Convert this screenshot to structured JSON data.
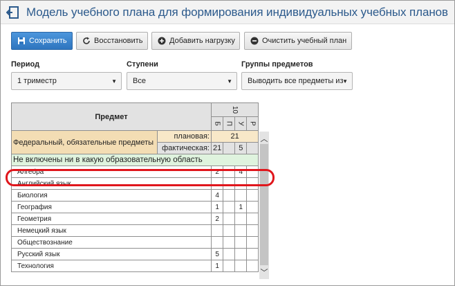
{
  "title": "Модель учебного плана для формирования индивидуальных учебных планов",
  "toolbar": {
    "save": "Сохранить",
    "restore": "Восстановить",
    "add_load": "Добавить нагрузку",
    "clear_plan": "Очистить учебный план"
  },
  "filters": {
    "period_label": "Период",
    "period_value": "1 триместр",
    "levels_label": "Ступени",
    "levels_value": "Все",
    "groups_label": "Группы предметов",
    "groups_value": "Выводить все предметы из"
  },
  "table": {
    "subject_header": "Предмет",
    "grade": "10",
    "subcols": [
      "Б",
      "П",
      "У",
      "Р"
    ],
    "federal_label": "Федеральный, обязательные предметы",
    "planned_label": "плановая:",
    "planned_value": "21",
    "actual_label": "фактическая:",
    "actual_values": [
      "21",
      "",
      "5",
      ""
    ],
    "section_label": "Не включены ни в какую образовательную область",
    "rows": [
      {
        "name": "Алгебра",
        "b": "2",
        "p": "",
        "u": "4",
        "r": ""
      },
      {
        "name": "Английский язык",
        "b": "",
        "p": "",
        "u": "",
        "r": ""
      },
      {
        "name": "Биология",
        "b": "4",
        "p": "",
        "u": "",
        "r": ""
      },
      {
        "name": "География",
        "b": "1",
        "p": "",
        "u": "1",
        "r": ""
      },
      {
        "name": "Геометрия",
        "b": "2",
        "p": "",
        "u": "",
        "r": ""
      },
      {
        "name": "Немецкий язык",
        "b": "",
        "p": "",
        "u": "",
        "r": ""
      },
      {
        "name": "Обществознание",
        "b": "",
        "p": "",
        "u": "",
        "r": ""
      },
      {
        "name": "Русский язык",
        "b": "5",
        "p": "",
        "u": "",
        "r": ""
      },
      {
        "name": "Технология",
        "b": "1",
        "p": "",
        "u": "",
        "r": ""
      }
    ]
  },
  "colors": {
    "title": "#2c5a8c",
    "primary_button": "#2e75bf",
    "federal_bg": "#f8e8c8",
    "section_bg": "#dff3de",
    "highlight": "#e0161c"
  }
}
